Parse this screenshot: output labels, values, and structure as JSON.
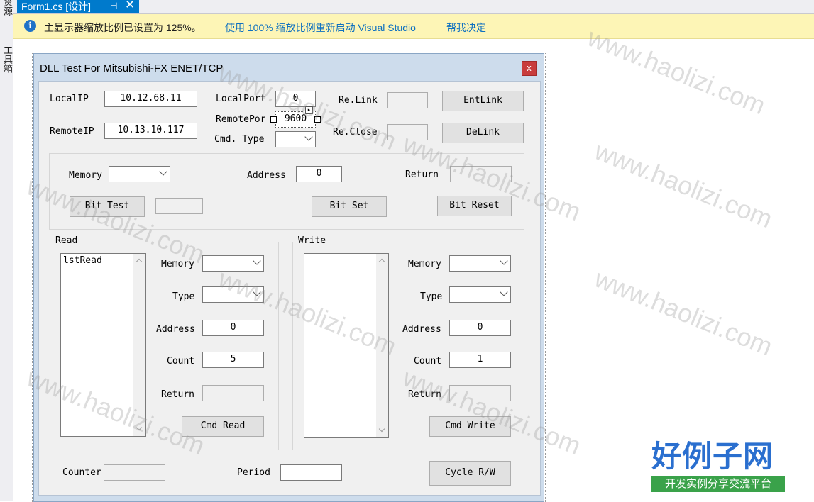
{
  "sidebar": {
    "tab1": "资源",
    "tab2": "工具箱"
  },
  "tab": {
    "title": "Form1.cs [设计]",
    "pin": "⊣",
    "close": "✕"
  },
  "infobar": {
    "icon": "i",
    "message": "主显示器缩放比例已设置为 125%。",
    "link_restart": "使用 100% 缩放比例重新启动 Visual Studio",
    "link_decide": "帮我决定"
  },
  "form": {
    "title": "DLL Test For Mitsubishi-FX ENET/TCP",
    "close": "x",
    "conn": {
      "localip_label": "LocalIP",
      "localip": "10.12.68.11",
      "remoteip_label": "RemoteIP",
      "remoteip": "10.13.10.117",
      "localport_label": "LocalPort",
      "localport": "0",
      "remoteport_label": "RemotePor",
      "remoteport": "9600",
      "cmdtype_label": "Cmd. Type",
      "relink_label": "Re.Link",
      "reclose_label": "Re.Close",
      "entlink": "EntLink",
      "delink": "DeLink"
    },
    "bit": {
      "memory_label": "Memory",
      "address_label": "Address",
      "address": "0",
      "return_label": "Return",
      "bit_test": "Bit Test",
      "bit_set": "Bit Set",
      "bit_reset": "Bit Reset"
    },
    "read": {
      "caption": "Read",
      "list_item": "lstRead",
      "memory_label": "Memory",
      "type_label": "Type",
      "address_label": "Address",
      "address": "0",
      "count_label": "Count",
      "count": "5",
      "return_label": "Return",
      "cmd": "Cmd Read"
    },
    "write": {
      "caption": "Write",
      "memory_label": "Memory",
      "type_label": "Type",
      "address_label": "Address",
      "address": "0",
      "count_label": "Count",
      "count": "1",
      "return_label": "Return",
      "cmd": "Cmd Write"
    },
    "bottom": {
      "counter_label": "Counter",
      "period_label": "Period",
      "cycle": "Cycle R/W"
    }
  },
  "watermark": {
    "text": "www.haolizi.com",
    "logo_main": "好例子网",
    "logo_sub": "开发实例分享交流平台"
  }
}
